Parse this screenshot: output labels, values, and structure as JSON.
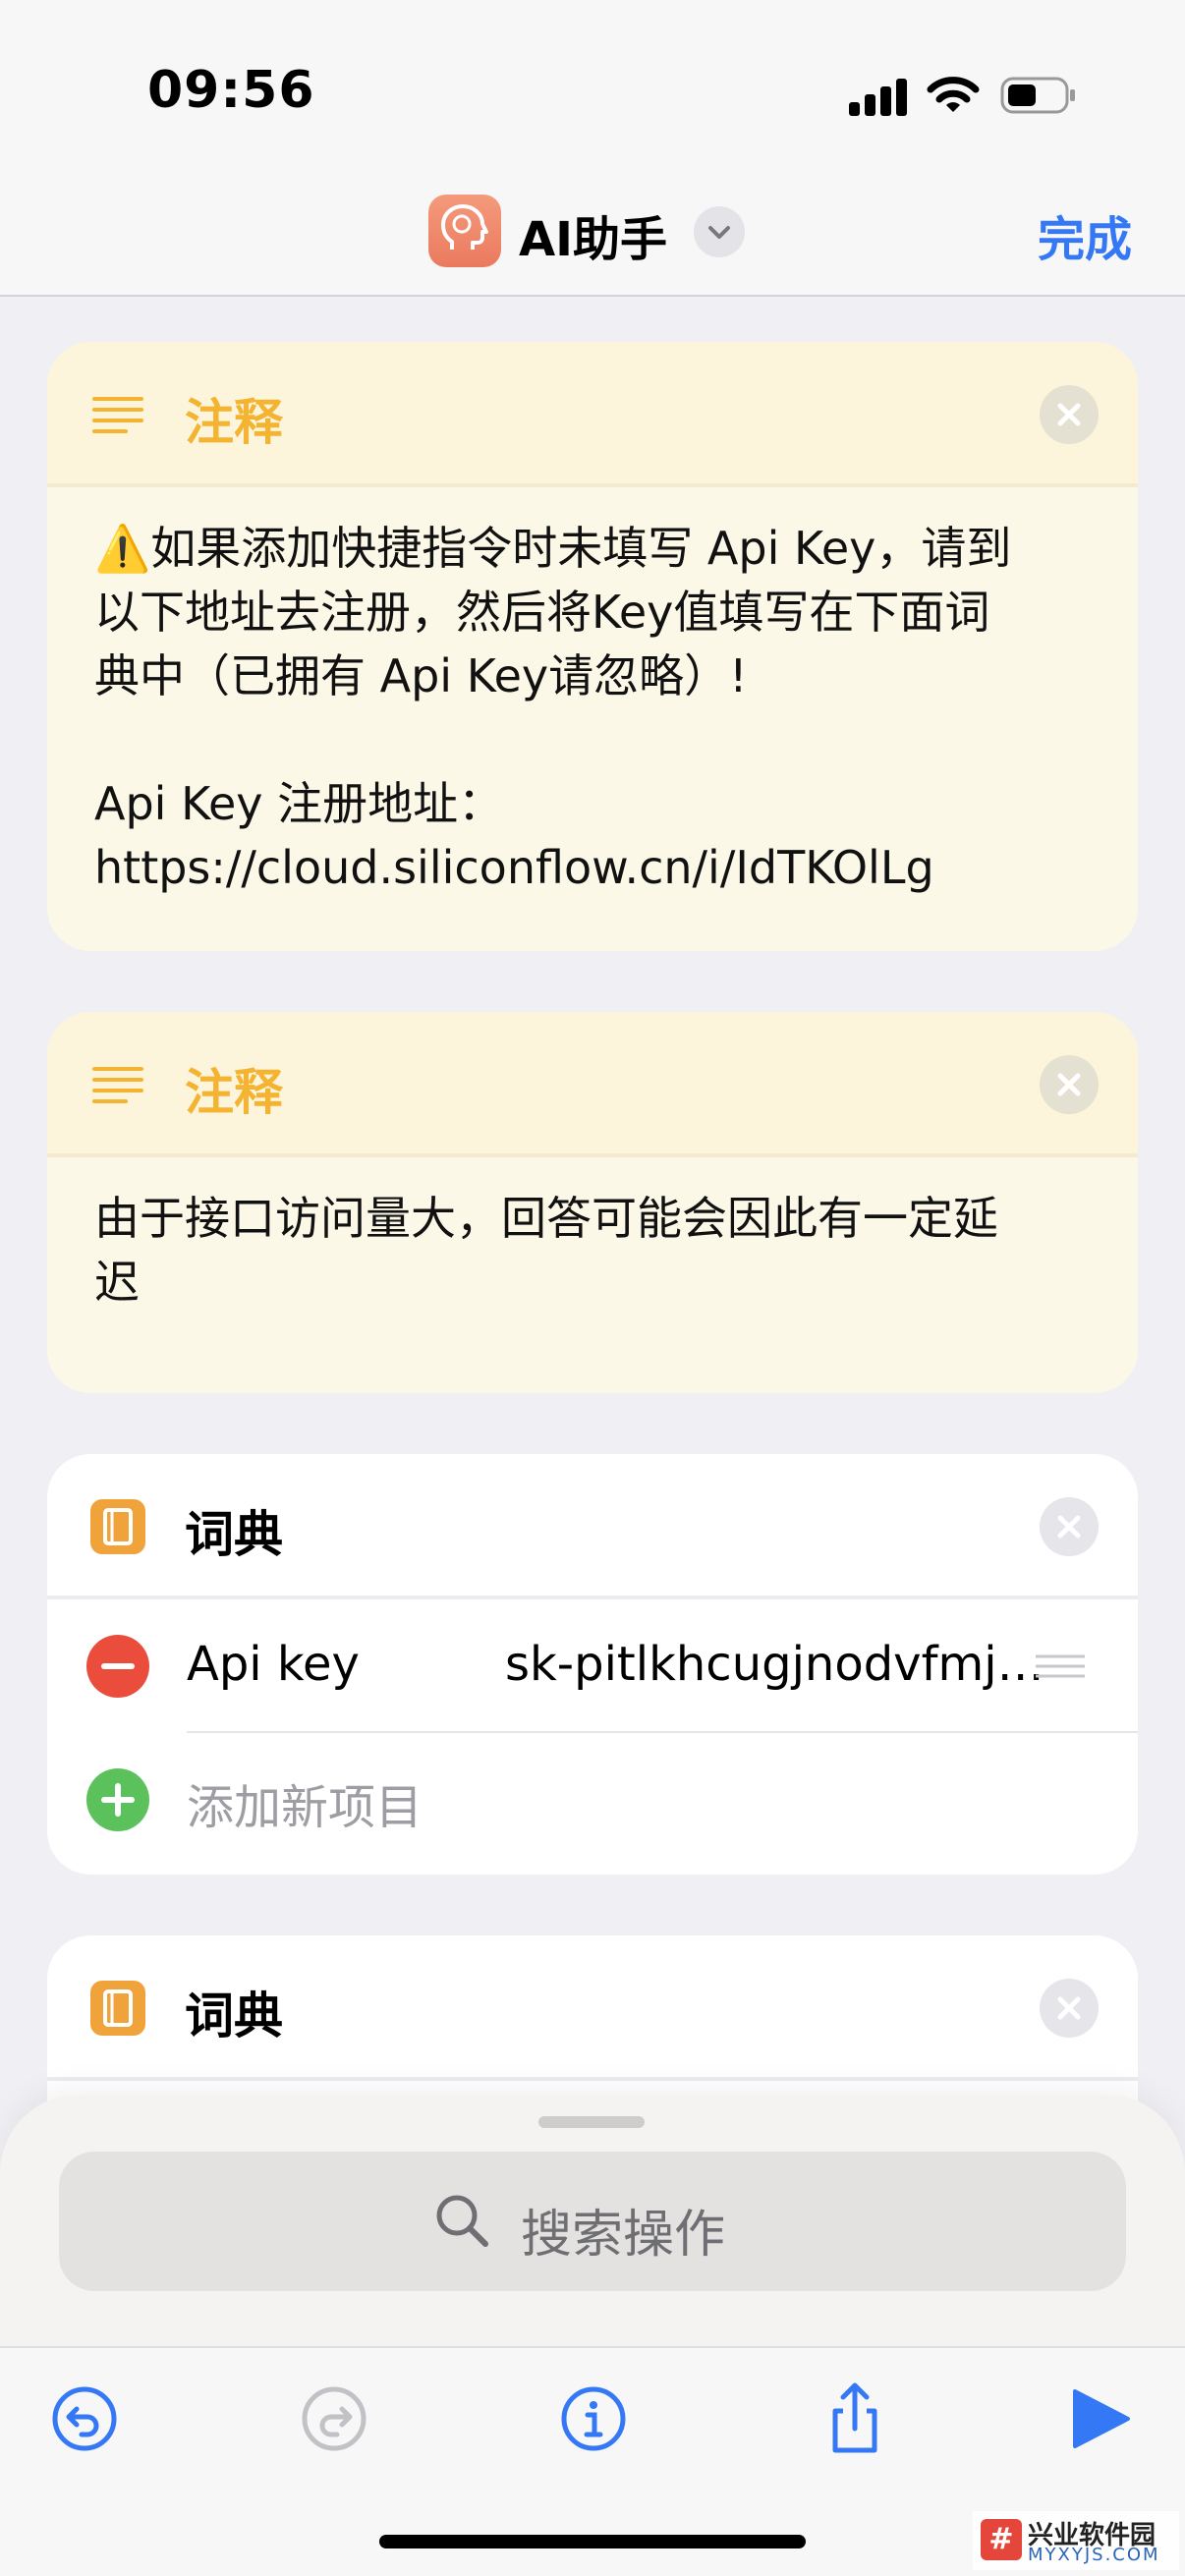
{
  "status_bar": {
    "time": "09:56"
  },
  "nav": {
    "title": "AI助手",
    "done_label": "完成"
  },
  "cards": [
    {
      "type": "note",
      "title": "注释",
      "icon": "text-lines-icon",
      "lines": [
        "⚠️如果添加快捷指令时未填写 Api Key，请到",
        "以下地址去注册，然后将Key值填写在下面词",
        "典中（已拥有 Api Key请忽略）!",
        "",
        "Api Key 注册地址：",
        "https://cloud.siliconflow.cn/i/IdTKOlLg"
      ]
    },
    {
      "type": "note",
      "title": "注释",
      "icon": "text-lines-icon",
      "lines": [
        "由于接口访问量大，回答可能会因此有一定延",
        "迟"
      ]
    },
    {
      "type": "dictionary",
      "title": "词典",
      "icon": "book-icon",
      "rows": [
        {
          "key": "Api key",
          "value": "sk-pitlkhcugjnodvfmjbwvdtrzuvyxgbnxeeljeplhbtvpkdkr"
        }
      ],
      "add_label": "添加新项目"
    },
    {
      "type": "dictionary",
      "title": "词典",
      "icon": "book-icon"
    }
  ],
  "search": {
    "label": "搜索操作"
  },
  "toolbar": {
    "buttons": [
      "undo-icon",
      "redo-icon",
      "info-icon",
      "share-icon",
      "play-icon"
    ]
  },
  "watermark": {
    "text": "兴业软件园",
    "sub": "MYXYJS.COM",
    "logo": "#"
  },
  "colors": {
    "accent": "#3478f6",
    "note_title": "#f4b331",
    "dict_icon": "#f0a33a",
    "remove": "#eb4d3d",
    "add": "#5bc15b",
    "play": "#3478f6"
  }
}
